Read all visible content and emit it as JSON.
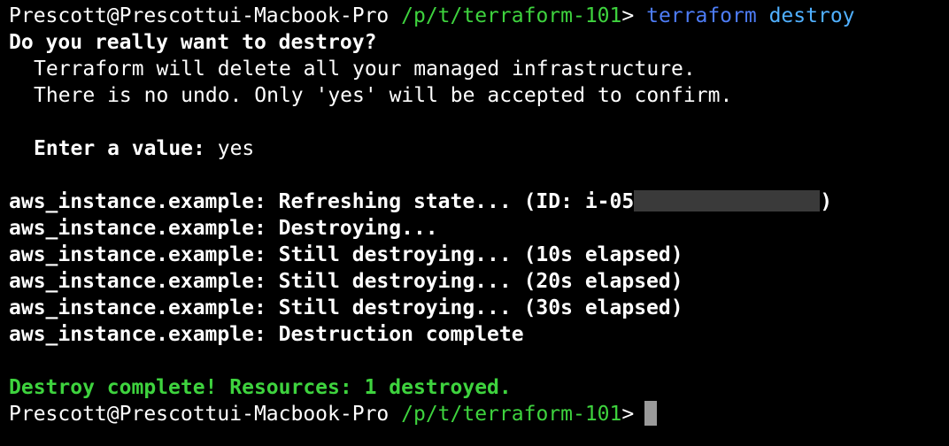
{
  "prompt": {
    "user_host": "Prescott@Prescottui-Macbook-Pro",
    "path": "/p/t/terraform-101",
    "symbol": ">"
  },
  "command": {
    "program": "terraform",
    "args": "destroy"
  },
  "confirm": {
    "question": "Do you really want to destroy?",
    "line1": "Terraform will delete all your managed infrastructure.",
    "line2": "There is no undo. Only 'yes' will be accepted to confirm.",
    "enter_label": "Enter a value:",
    "enter_value": " yes"
  },
  "output": {
    "resource": "aws_instance.example:",
    "refreshing_prefix": " Refreshing state... (ID: i-05",
    "refreshing_suffix": ")",
    "destroying": " Destroying...",
    "still_10": " Still destroying... (10s elapsed)",
    "still_20": " Still destroying... (20s elapsed)",
    "still_30": " Still destroying... (30s elapsed)",
    "complete": " Destruction complete"
  },
  "summary": "Destroy complete! Resources: 1 destroyed.",
  "colors": {
    "green": "#3ed33e",
    "blue": "#4d7cf6",
    "background": "#000000"
  }
}
